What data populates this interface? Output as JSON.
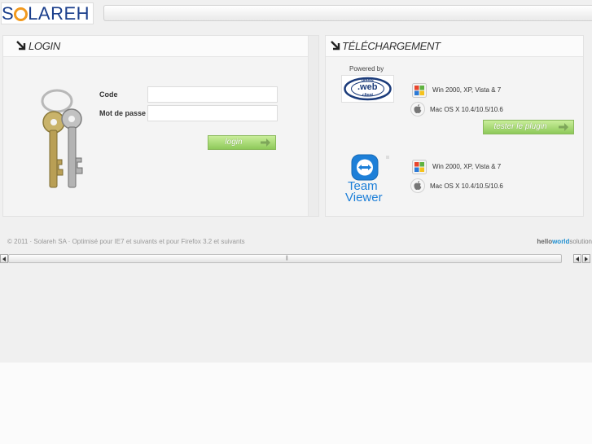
{
  "header": {
    "logo_text_a": "S",
    "logo_text_b": "LAREH"
  },
  "login": {
    "title": "LOGIN",
    "code_label": "Code",
    "password_label": "Mot de passe",
    "code_value": "",
    "password_value": "",
    "login_button": "login"
  },
  "download": {
    "title": "TÉLÉCHARGEMENT",
    "powered_by": "Powered by",
    "owc": {
      "logo_top": "omnis",
      "logo_mid": ".web",
      "logo_bottom": "client",
      "windows_label": "Win 2000, XP, Vista & 7",
      "mac_label": "Mac OS X 10.4/10.5/10.6",
      "test_button": "tester le plugin"
    },
    "teamviewer": {
      "logo_line1": "Team",
      "logo_line2": "Viewer",
      "windows_label": "Win 2000, XP, Vista & 7",
      "mac_label": "Mac OS X 10.4/10.5/10.6"
    }
  },
  "footer": {
    "copyright": "© 2011 · Solareh SA · Optimisé pour IE7 et suivants et pour Firefox 3.2 et suivants",
    "credit_a": "hello",
    "credit_b": "world",
    "credit_c": "solution"
  },
  "colors": {
    "brand_blue": "#1b3f8c",
    "brand_orange": "#f29a1f",
    "button_green": "#8ec95a"
  }
}
